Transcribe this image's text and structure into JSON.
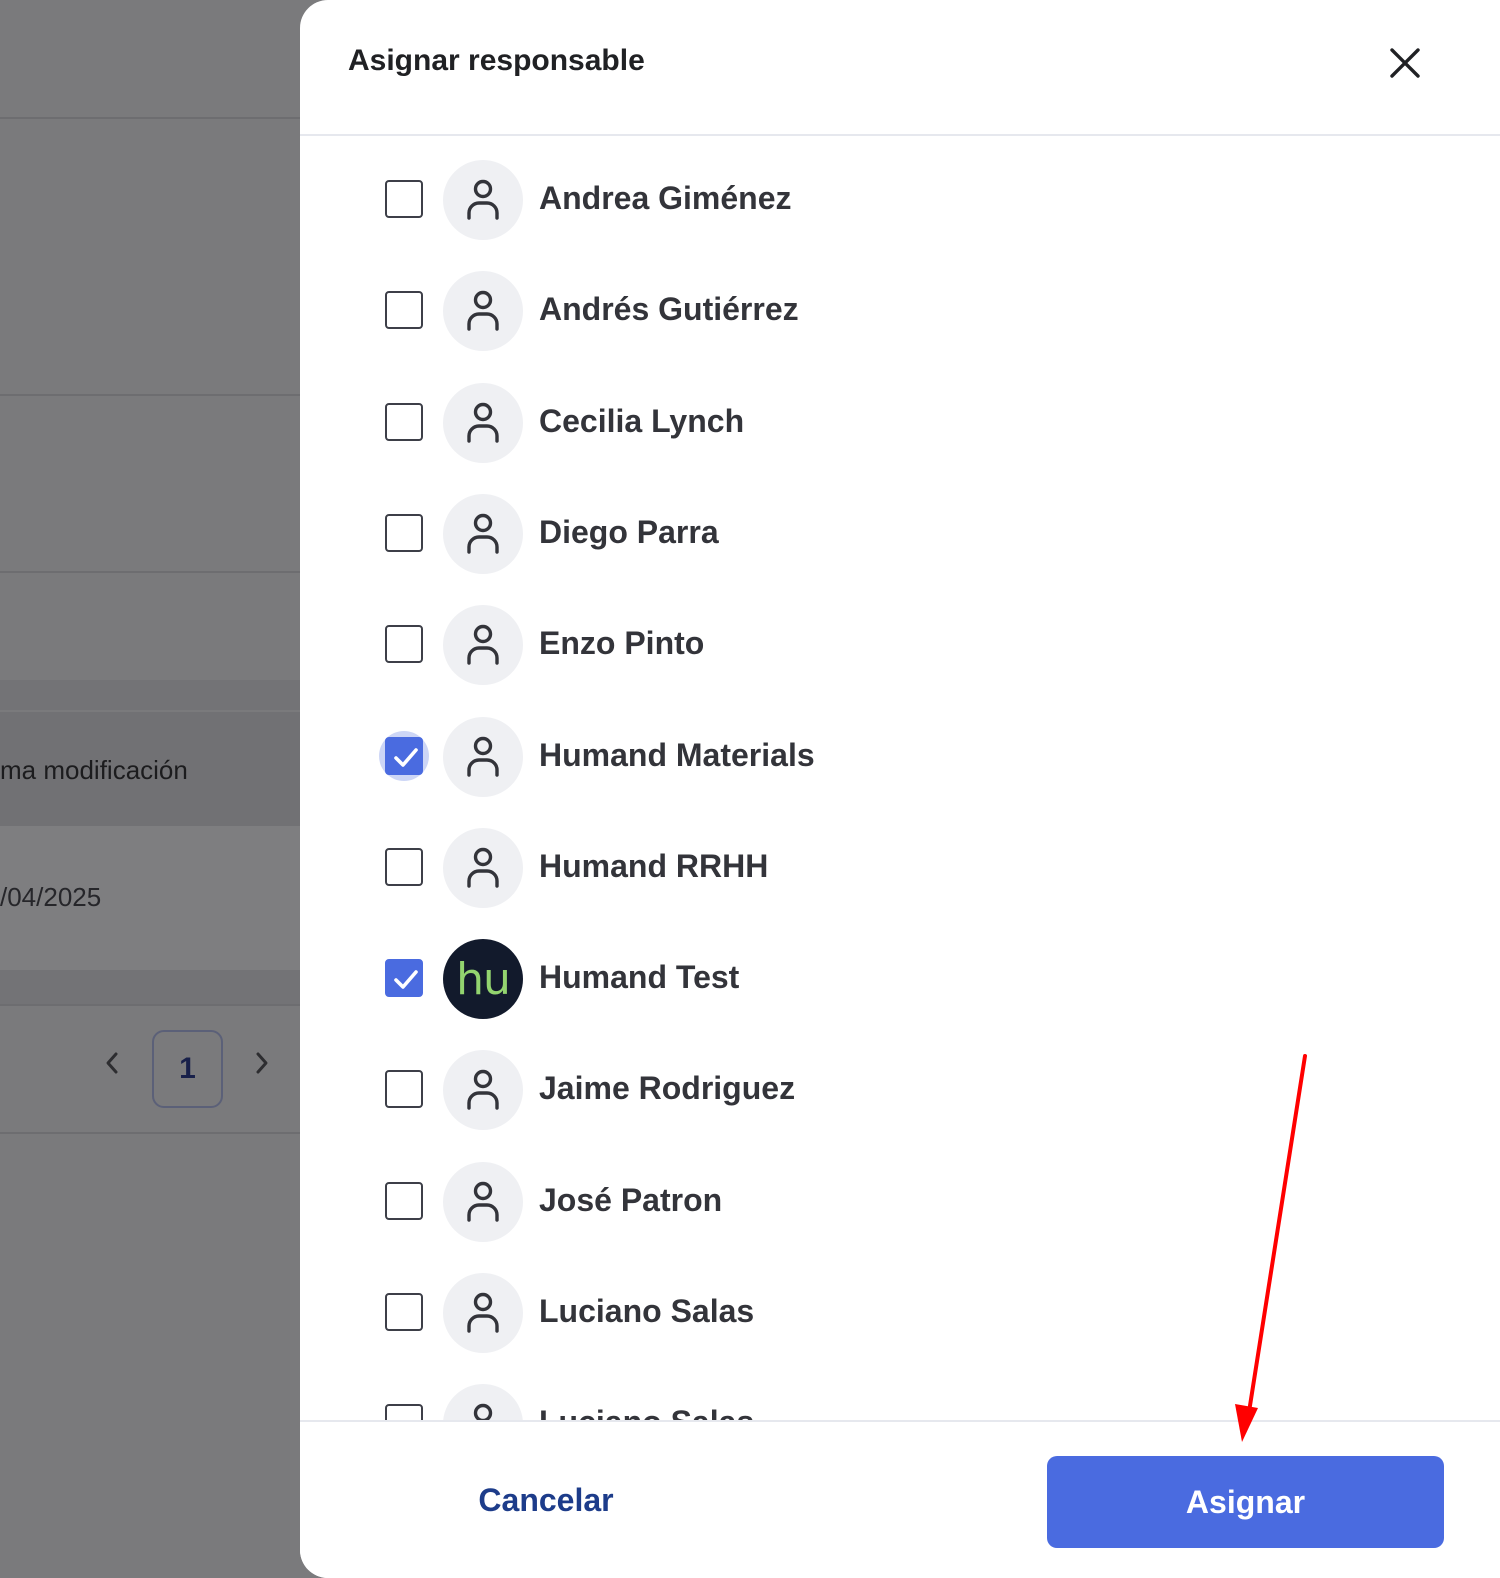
{
  "background": {
    "column_header": "ma modificación",
    "cell_date": "/04/2025",
    "pagination": {
      "prev_icon": "chevron-left-icon",
      "current_page": "1",
      "next_icon": "chevron-right-icon"
    }
  },
  "drawer": {
    "title": "Asignar responsable",
    "close_icon": "close-icon",
    "users": [
      {
        "name": "Andrea Giménez",
        "checked": false,
        "avatar": "user-icon"
      },
      {
        "name": "Andrés Gutiérrez",
        "checked": false,
        "avatar": "user-icon"
      },
      {
        "name": "Cecilia Lynch",
        "checked": false,
        "avatar": "user-icon"
      },
      {
        "name": "Diego Parra",
        "checked": false,
        "avatar": "user-icon"
      },
      {
        "name": "Enzo Pinto",
        "checked": false,
        "avatar": "user-icon"
      },
      {
        "name": "Humand Materials",
        "checked": true,
        "focused": true,
        "avatar": "user-icon"
      },
      {
        "name": "Humand RRHH",
        "checked": false,
        "avatar": "user-icon"
      },
      {
        "name": "Humand Test",
        "checked": true,
        "avatar": "brand-logo",
        "avatar_text": "hu"
      },
      {
        "name": "Jaime Rodriguez",
        "checked": false,
        "avatar": "user-icon"
      },
      {
        "name": "José Patron",
        "checked": false,
        "avatar": "user-icon"
      },
      {
        "name": "Luciano Salas",
        "checked": false,
        "avatar": "user-icon"
      },
      {
        "name": "Luciano Salas",
        "checked": false,
        "avatar": "user-icon"
      }
    ],
    "footer": {
      "cancel_label": "Cancelar",
      "assign_label": "Asignar"
    }
  },
  "colors": {
    "accent": "#4a6be0",
    "cancel_text": "#1d3c8a",
    "annotation_arrow": "#ff0000",
    "brand_avatar_bg": "#121a2c",
    "brand_avatar_text": "#93d46f"
  }
}
